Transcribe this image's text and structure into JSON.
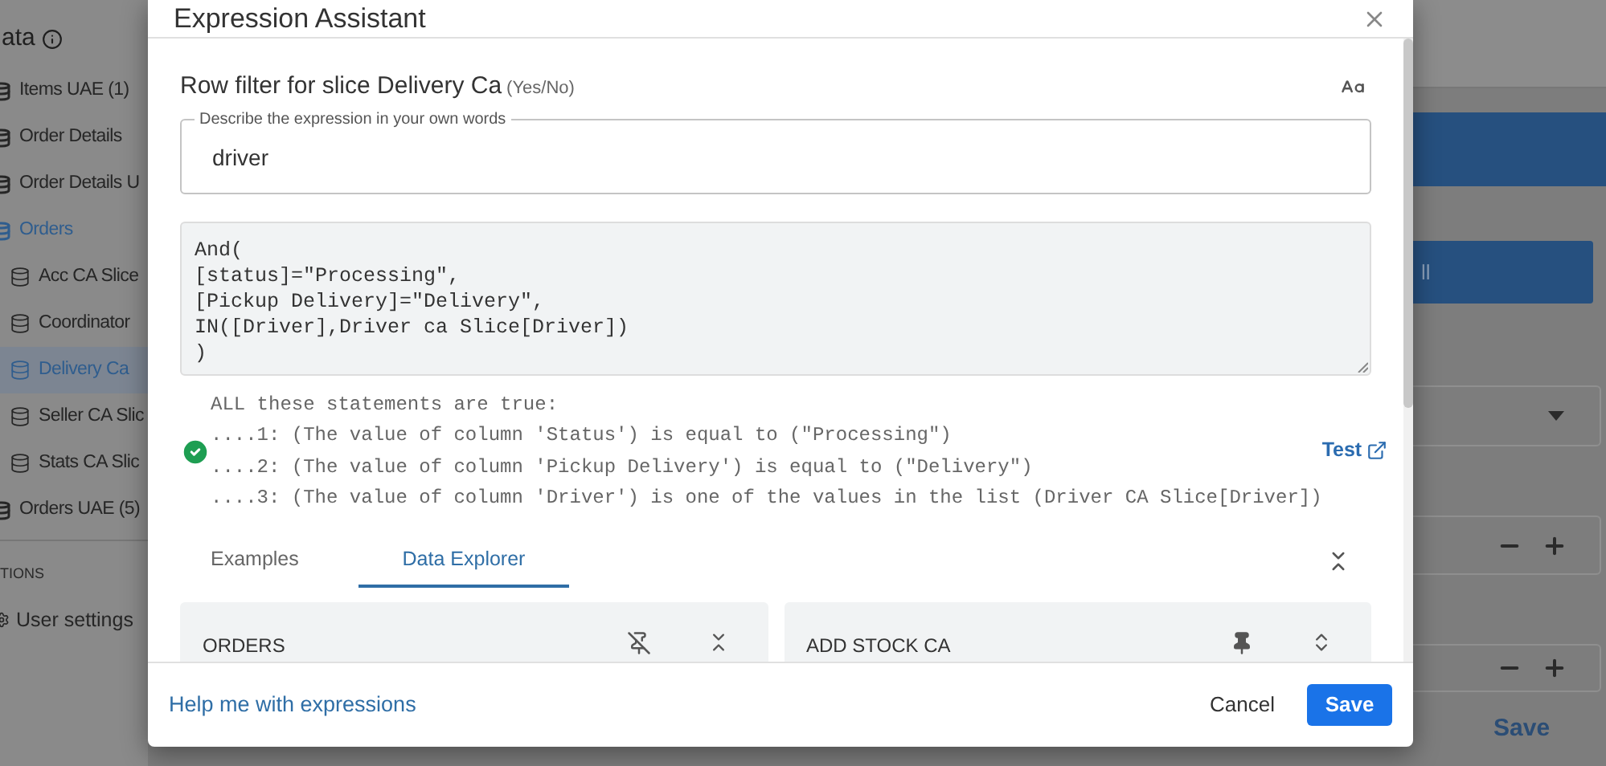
{
  "sidebar": {
    "title": "ata",
    "items": [
      {
        "label": "Items UAE (1)",
        "selected": false
      },
      {
        "label": "Order Details",
        "selected": false
      },
      {
        "label": "Order Details U",
        "selected": false
      },
      {
        "label": "Orders",
        "selected": false,
        "expanded": true,
        "children": [
          {
            "label": "Acc CA Slice",
            "selected": false
          },
          {
            "label": "Coordinator",
            "selected": false
          },
          {
            "label": "Delivery Ca",
            "selected": true
          },
          {
            "label": "Seller CA Slic",
            "selected": false
          },
          {
            "label": "Stats CA Slic",
            "selected": false
          }
        ]
      },
      {
        "label": "Orders UAE (5)",
        "selected": false
      }
    ],
    "section": "TIONS",
    "settings": "User settings"
  },
  "dialog": {
    "title": "Expression Assistant",
    "heading": "Row filter for slice Delivery Ca",
    "type_hint": "(Yes/No)",
    "description": {
      "label": "Describe the expression in your own words",
      "value": "driver"
    },
    "expression": "And(\n[status]=\"Processing\",\n[Pickup Delivery]=\"Delivery\",\nIN([Driver],Driver ca Slice[Driver])\n)",
    "result": {
      "valid": true,
      "summary": "ALL these statements are true:",
      "statements": [
        "....1: (The value of column 'Status') is equal to (\"Processing\")",
        "....2: (The value of column 'Pickup Delivery') is equal to (\"Delivery\")",
        "....3: (The value of column 'Driver') is one of the values in the list (Driver CA Slice[Driver])"
      ]
    },
    "test_link": "Test",
    "tabs": [
      {
        "label": "Examples",
        "selected": false
      },
      {
        "label": "Data Explorer",
        "selected": true
      }
    ],
    "tables": [
      {
        "name": "ORDERS",
        "pinned": false
      },
      {
        "name": "ADD STOCK CA",
        "pinned": true
      }
    ],
    "help_link": "Help me with expressions",
    "cancel": "Cancel",
    "save": "Save"
  },
  "background_panel": {
    "button": "ll",
    "save": "Save"
  }
}
